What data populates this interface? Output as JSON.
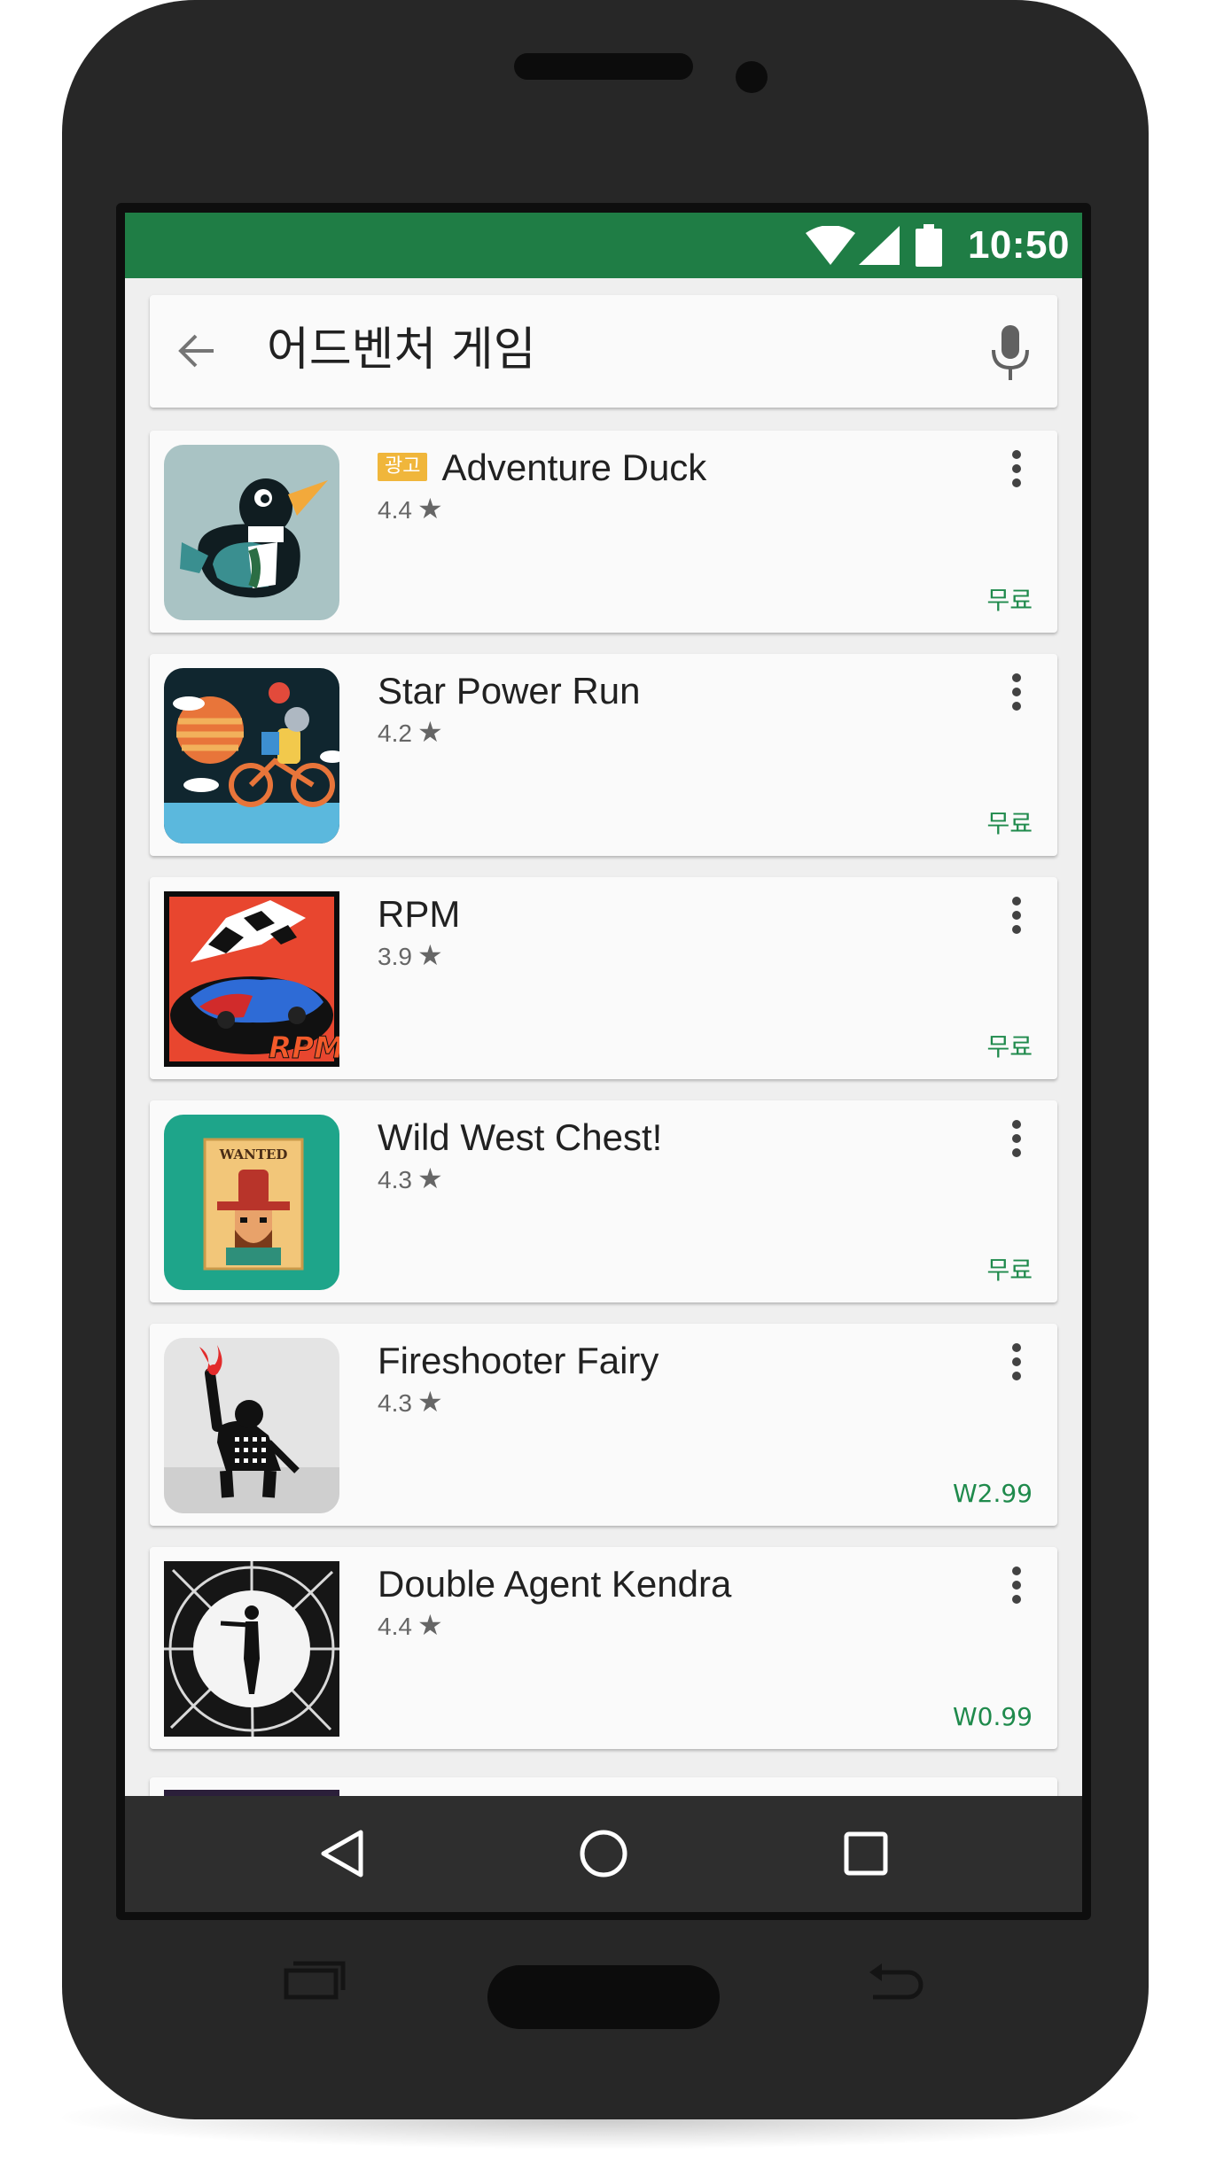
{
  "status_bar": {
    "time": "10:50",
    "icons": [
      "wifi-icon",
      "signal-icon",
      "battery-icon"
    ],
    "color": "#1f7d45"
  },
  "search": {
    "query": "어드벤처 게임",
    "back_icon": "arrow-left-icon",
    "mic_icon": "mic-icon"
  },
  "apps": [
    {
      "title": "Adventure Duck",
      "badge": "광고",
      "rating": "4.4",
      "price": "무료",
      "icon": "duck-icon"
    },
    {
      "title": "Star Power Run",
      "badge": "",
      "rating": "4.2",
      "price": "무료",
      "icon": "cyclist-icon"
    },
    {
      "title": "RPM",
      "badge": "",
      "rating": "3.9",
      "price": "무료",
      "icon": "race-car-icon"
    },
    {
      "title": "Wild West Chest!",
      "badge": "",
      "rating": "4.3",
      "price": "무료",
      "icon": "wanted-poster-icon"
    },
    {
      "title": "Fireshooter Fairy",
      "badge": "",
      "rating": "4.3",
      "price": "W2.99",
      "icon": "fire-fairy-icon"
    },
    {
      "title": "Double Agent Kendra",
      "badge": "",
      "rating": "4.4",
      "price": "W0.99",
      "icon": "spy-silhouette-icon"
    }
  ],
  "rating_star": "★",
  "colors": {
    "accent_green": "#1f7d45",
    "price_green": "#1f8a4c",
    "ad_badge": "#f0b63b",
    "phone_body": "#272727"
  },
  "navigation": [
    "back-triangle-icon",
    "home-circle-icon",
    "recent-square-icon"
  ]
}
